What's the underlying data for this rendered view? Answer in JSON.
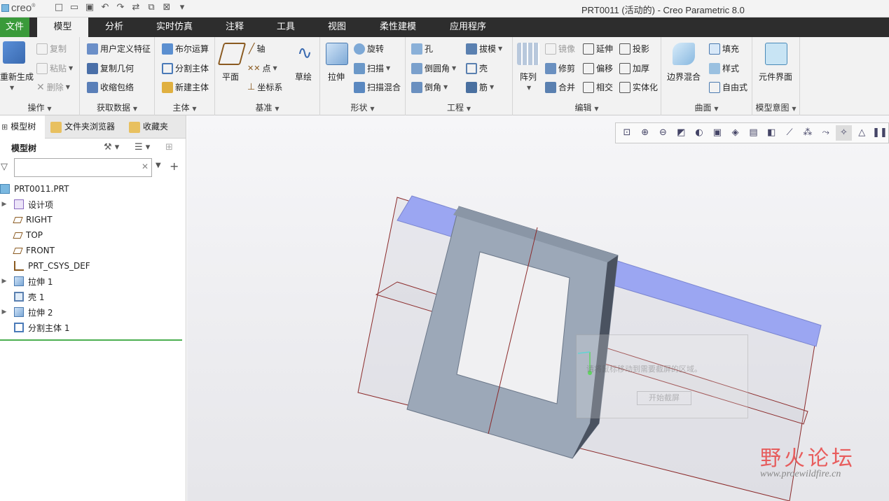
{
  "app": {
    "logo_text": "creo",
    "window_title": "PRT0011 (活动的) - Creo Parametric 8.0"
  },
  "tabs": [
    "文件",
    "模型",
    "分析",
    "实时仿真",
    "注释",
    "工具",
    "视图",
    "柔性建模",
    "应用程序"
  ],
  "ribbon": {
    "operations": {
      "label": "操作",
      "regenerate": "重新生成",
      "copy": "复制",
      "paste": "粘贴",
      "delete": "删除"
    },
    "get_data": {
      "label": "获取数据",
      "udf": "用户定义特征",
      "copy_geom": "复制几何",
      "shrinkwrap": "收缩包络"
    },
    "body": {
      "label": "主体",
      "boolean": "布尔运算",
      "split": "分割主体",
      "new": "新建主体"
    },
    "datum": {
      "label": "基准",
      "plane": "平面",
      "axis": "轴",
      "point": "点",
      "csys": "坐标系",
      "sketch": "草绘"
    },
    "shapes": {
      "label": "形状",
      "extrude": "拉伸",
      "revolve": "旋转",
      "sweep": "扫描",
      "swept_blend": "扫描混合"
    },
    "engineering": {
      "label": "工程",
      "hole": "孔",
      "round": "倒圆角",
      "chamfer": "倒角",
      "draft": "拔模",
      "shell": "壳",
      "rib": "筋"
    },
    "editing": {
      "label": "编辑",
      "pattern": "阵列",
      "mirror": "镜像",
      "trim": "修剪",
      "merge": "合并",
      "extend": "延伸",
      "offset": "偏移",
      "intersect": "相交",
      "project": "投影",
      "thicken": "加厚",
      "solidify": "实体化"
    },
    "surfaces": {
      "label": "曲面",
      "boundary_blend": "边界混合",
      "fill": "填充",
      "style": "样式",
      "freestyle": "自由式"
    },
    "model_intent": {
      "label": "模型意图",
      "component_interface": "元件界面"
    }
  },
  "panel": {
    "tabs": [
      "模型树",
      "文件夹浏览器",
      "收藏夹"
    ],
    "tree_title": "模型树",
    "filter_placeholder": "",
    "tree": [
      {
        "label": "PRT0011.PRT",
        "expandable": false,
        "icon": "part-icon"
      },
      {
        "label": "设计项",
        "expandable": true,
        "icon": "design-items-icon"
      },
      {
        "label": "RIGHT",
        "expandable": false,
        "icon": "datum-plane-icon"
      },
      {
        "label": "TOP",
        "expandable": false,
        "icon": "datum-plane-icon"
      },
      {
        "label": "FRONT",
        "expandable": false,
        "icon": "datum-plane-icon"
      },
      {
        "label": "PRT_CSYS_DEF",
        "expandable": false,
        "icon": "csys-icon"
      },
      {
        "label": "拉伸 1",
        "expandable": true,
        "icon": "extrude-icon"
      },
      {
        "label": "壳 1",
        "expandable": false,
        "icon": "shell-icon"
      },
      {
        "label": "拉伸 2",
        "expandable": true,
        "icon": "extrude-icon"
      },
      {
        "label": "分割主体 1",
        "expandable": false,
        "icon": "split-body-icon"
      }
    ]
  },
  "viewport": {
    "dialog_text": "请将鼠标移动到需要截屏的区域。",
    "dialog_button": "开始截屏"
  },
  "watermark": {
    "cn": "野火论坛",
    "url": "www.proewildfire.cn"
  },
  "colors": {
    "accent_green": "#3a9a3a",
    "tabbar": "#2d2d2d",
    "part_gray": "#9aa6b5",
    "surface_blue": "#9aa4f0",
    "datum_red": "#8b2a2a"
  }
}
